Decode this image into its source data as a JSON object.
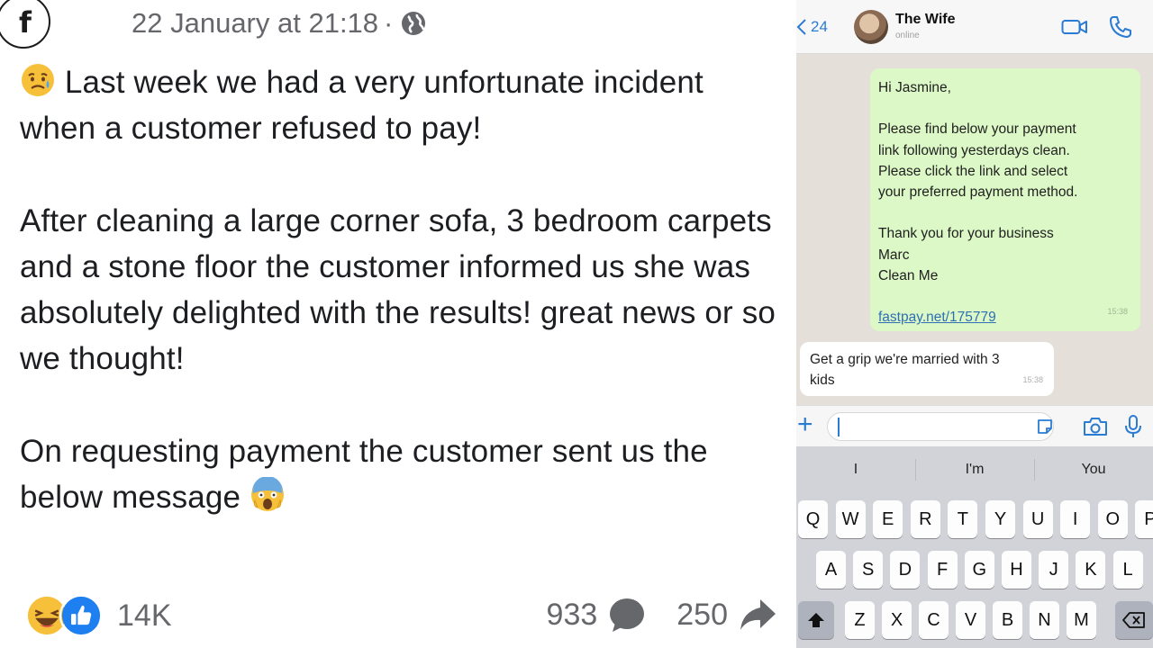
{
  "facebook_post": {
    "timestamp": "22 January at 21:18",
    "separator": "·",
    "paragraphs": [
      "Last week we had a very unfortunate incident when a customer refused to pay!",
      "After cleaning a large corner sofa, 3 bedroom carpets and a stone floor the customer informed us she was absolutely delighted with the results! great news or so we thought!",
      "On requesting payment the customer sent us the below message"
    ],
    "reactions": [
      "laughing-emoji",
      "like-icon"
    ],
    "reaction_count": "14K",
    "comment_count": "933",
    "share_count": "250"
  },
  "whatsapp": {
    "back_count": "24",
    "contact_name": "The Wife",
    "contact_status": "online",
    "outgoing_message": {
      "lines": [
        "Hi Jasmine,",
        "",
        "Please find below your payment",
        "link following yesterdays clean.",
        "Please click the link and select",
        "your preferred payment method.",
        "",
        "Thank you for your business",
        "Marc",
        "Clean Me",
        ""
      ],
      "link": "fastpay.net/175779",
      "time": "15:38"
    },
    "incoming_message": {
      "lines": [
        "Get a grip we're married with 3",
        "kids"
      ],
      "time": "15:38"
    },
    "keyboard": {
      "suggestions": [
        "I",
        "I'm",
        "You"
      ],
      "row1": [
        "Q",
        "W",
        "E",
        "R",
        "T",
        "Y",
        "U",
        "I",
        "O",
        "P"
      ],
      "row2": [
        "A",
        "S",
        "D",
        "F",
        "G",
        "H",
        "J",
        "K",
        "L"
      ],
      "row3": [
        "Z",
        "X",
        "C",
        "V",
        "B",
        "N",
        "M"
      ]
    }
  },
  "colors": {
    "facebook_meta": "#65676b",
    "whatsapp_blue": "#2a7bd3",
    "outgoing_bubble": "#dcf8c6",
    "chat_background": "#e4dfd8",
    "keyboard_background": "#d1d3d9"
  }
}
